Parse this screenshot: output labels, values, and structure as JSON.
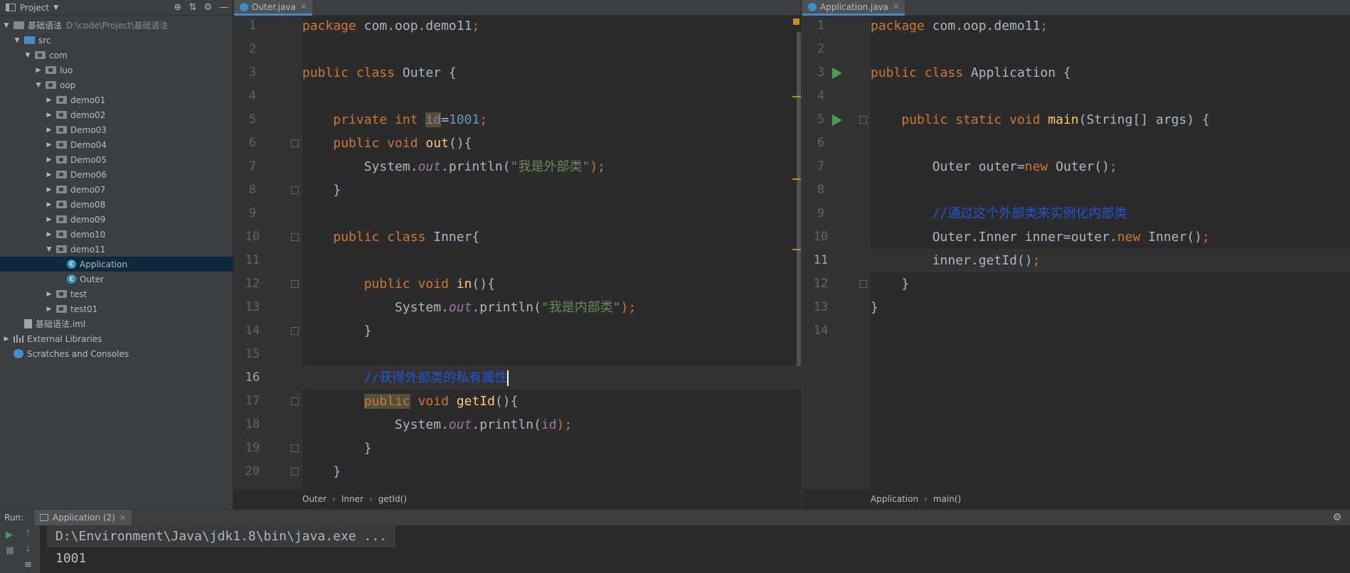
{
  "project_panel": {
    "title": "Project",
    "tree": [
      {
        "label": "基础语法",
        "hint": "D:\\code\\Project\\基础语法",
        "depth": 0,
        "arrow": "down",
        "icon": "folder"
      },
      {
        "label": "src",
        "depth": 1,
        "arrow": "down",
        "icon": "folder-blue"
      },
      {
        "label": "com",
        "depth": 2,
        "arrow": "down",
        "icon": "package"
      },
      {
        "label": "luo",
        "depth": 3,
        "arrow": "right",
        "icon": "package"
      },
      {
        "label": "oop",
        "depth": 3,
        "arrow": "down",
        "icon": "package"
      },
      {
        "label": "demo01",
        "depth": 4,
        "arrow": "right",
        "icon": "package"
      },
      {
        "label": "demo02",
        "depth": 4,
        "arrow": "right",
        "icon": "package"
      },
      {
        "label": "Demo03",
        "depth": 4,
        "arrow": "right",
        "icon": "package"
      },
      {
        "label": "Demo04",
        "depth": 4,
        "arrow": "right",
        "icon": "package"
      },
      {
        "label": "Demo05",
        "depth": 4,
        "arrow": "right",
        "icon": "package"
      },
      {
        "label": "Demo06",
        "depth": 4,
        "arrow": "right",
        "icon": "package"
      },
      {
        "label": "demo07",
        "depth": 4,
        "arrow": "right",
        "icon": "package"
      },
      {
        "label": "demo08",
        "depth": 4,
        "arrow": "right",
        "icon": "package"
      },
      {
        "label": "demo09",
        "depth": 4,
        "arrow": "right",
        "icon": "package"
      },
      {
        "label": "demo10",
        "depth": 4,
        "arrow": "right",
        "icon": "package"
      },
      {
        "label": "demo11",
        "depth": 4,
        "arrow": "down",
        "icon": "package"
      },
      {
        "label": "Application",
        "depth": 5,
        "arrow": "",
        "icon": "class",
        "selected": true
      },
      {
        "label": "Outer",
        "depth": 5,
        "arrow": "",
        "icon": "class"
      },
      {
        "label": "test",
        "depth": 4,
        "arrow": "right",
        "icon": "package"
      },
      {
        "label": "test01",
        "depth": 4,
        "arrow": "right",
        "icon": "package"
      },
      {
        "label": "基础语法.iml",
        "depth": 1,
        "arrow": "",
        "icon": "file"
      },
      {
        "label": "External Libraries",
        "depth": 0,
        "arrow": "right",
        "icon": "library"
      },
      {
        "label": "Scratches and Consoles",
        "depth": 0,
        "arrow": "",
        "icon": "scratch"
      }
    ]
  },
  "editor_left": {
    "tab": "Outer.java",
    "current_line": 16,
    "breadcrumb": [
      "Outer",
      "Inner",
      "getId()"
    ],
    "lines": [
      {
        "n": "1",
        "tokens": [
          {
            "t": "package ",
            "c": "kw"
          },
          {
            "t": "com.oop.demo11"
          },
          {
            "t": ";",
            "c": "kw"
          }
        ]
      },
      {
        "n": "2",
        "tokens": []
      },
      {
        "n": "3",
        "tokens": [
          {
            "t": "public class ",
            "c": "kw"
          },
          {
            "t": "Outer {"
          }
        ]
      },
      {
        "n": "4",
        "tokens": []
      },
      {
        "n": "5",
        "tokens": [
          {
            "t": "    "
          },
          {
            "t": "private int ",
            "c": "kw"
          },
          {
            "t": "id",
            "c": "fldn hl"
          },
          {
            "t": "="
          },
          {
            "t": "1001",
            "c": "num"
          },
          {
            "t": ";",
            "c": "kw"
          }
        ]
      },
      {
        "n": "6",
        "fold": true,
        "tokens": [
          {
            "t": "    "
          },
          {
            "t": "public void ",
            "c": "kw"
          },
          {
            "t": "out",
            "c": "fn"
          },
          {
            "t": "(){"
          }
        ]
      },
      {
        "n": "7",
        "tokens": [
          {
            "t": "        System."
          },
          {
            "t": "out",
            "c": "fld"
          },
          {
            "t": ".println("
          },
          {
            "t": "\"我是外部类\"",
            "c": "str"
          },
          {
            "t": ");",
            "c": "kw"
          }
        ]
      },
      {
        "n": "8",
        "fold": true,
        "tokens": [
          {
            "t": "    }"
          }
        ]
      },
      {
        "n": "9",
        "tokens": []
      },
      {
        "n": "10",
        "fold": true,
        "tokens": [
          {
            "t": "    "
          },
          {
            "t": "public class ",
            "c": "kw"
          },
          {
            "t": "Inner{"
          }
        ]
      },
      {
        "n": "11",
        "tokens": []
      },
      {
        "n": "12",
        "fold": true,
        "tokens": [
          {
            "t": "        "
          },
          {
            "t": "public void ",
            "c": "kw"
          },
          {
            "t": "in",
            "c": "fn"
          },
          {
            "t": "(){"
          }
        ]
      },
      {
        "n": "13",
        "tokens": [
          {
            "t": "            System."
          },
          {
            "t": "out",
            "c": "fld"
          },
          {
            "t": ".println("
          },
          {
            "t": "\"我是内部类\"",
            "c": "str"
          },
          {
            "t": ");",
            "c": "kw"
          }
        ]
      },
      {
        "n": "14",
        "fold": true,
        "tokens": [
          {
            "t": "        }"
          }
        ]
      },
      {
        "n": "15",
        "tokens": []
      },
      {
        "n": "16",
        "caret": true,
        "tokens": [
          {
            "t": "        "
          },
          {
            "t": "//获得外部类的私有属性",
            "c": "cmt"
          }
        ]
      },
      {
        "n": "17",
        "fold": true,
        "tokens": [
          {
            "t": "        "
          },
          {
            "t": "public",
            "c": "kw hl"
          },
          {
            "t": " void ",
            "c": "kw"
          },
          {
            "t": "getId",
            "c": "fn"
          },
          {
            "t": "(){"
          }
        ]
      },
      {
        "n": "18",
        "tokens": [
          {
            "t": "            System."
          },
          {
            "t": "out",
            "c": "fld"
          },
          {
            "t": ".println("
          },
          {
            "t": "id",
            "c": "fldn"
          },
          {
            "t": ");",
            "c": "kw"
          }
        ]
      },
      {
        "n": "19",
        "fold": true,
        "tokens": [
          {
            "t": "        }"
          }
        ]
      },
      {
        "n": "20",
        "fold": true,
        "tokens": [
          {
            "t": "    }"
          }
        ]
      }
    ]
  },
  "editor_right": {
    "tab": "Application.java",
    "current_line": 11,
    "breadcrumb": [
      "Application",
      "main()"
    ],
    "lines": [
      {
        "n": "1",
        "tokens": [
          {
            "t": "package ",
            "c": "kw"
          },
          {
            "t": "com.oop.demo11"
          },
          {
            "t": ";",
            "c": "kw"
          }
        ]
      },
      {
        "n": "2",
        "tokens": []
      },
      {
        "n": "3",
        "run": true,
        "tokens": [
          {
            "t": "public class ",
            "c": "kw"
          },
          {
            "t": "Application {"
          }
        ]
      },
      {
        "n": "4",
        "tokens": []
      },
      {
        "n": "5",
        "run": true,
        "fold": true,
        "tokens": [
          {
            "t": "    "
          },
          {
            "t": "public static void ",
            "c": "kw"
          },
          {
            "t": "main",
            "c": "fn"
          },
          {
            "t": "(String[] args) {"
          }
        ]
      },
      {
        "n": "6",
        "tokens": []
      },
      {
        "n": "7",
        "tokens": [
          {
            "t": "        Outer outer="
          },
          {
            "t": "new ",
            "c": "kw"
          },
          {
            "t": "Outer()"
          },
          {
            "t": ";",
            "c": "kw"
          }
        ]
      },
      {
        "n": "8",
        "tokens": []
      },
      {
        "n": "9",
        "tokens": [
          {
            "t": "        "
          },
          {
            "t": "//通过这个外部类来实例化内部类",
            "c": "cmt"
          }
        ]
      },
      {
        "n": "10",
        "tokens": [
          {
            "t": "        Outer.Inner inner=outer."
          },
          {
            "t": "new ",
            "c": "kw"
          },
          {
            "t": "Inner()"
          },
          {
            "t": ";",
            "c": "kw"
          }
        ]
      },
      {
        "n": "11",
        "tokens": [
          {
            "t": "        inner.getId()"
          },
          {
            "t": ";",
            "c": "kw"
          }
        ]
      },
      {
        "n": "12",
        "fold": true,
        "tokens": [
          {
            "t": "    }"
          }
        ]
      },
      {
        "n": "13",
        "tokens": [
          {
            "t": "}"
          }
        ]
      },
      {
        "n": "14",
        "tokens": []
      }
    ]
  },
  "run_panel": {
    "label": "Run:",
    "tab": "Application (2)",
    "console": {
      "command": "D:\\Environment\\Java\\jdk1.8\\bin\\java.exe ...",
      "output": "1001"
    }
  },
  "colors": {
    "keyword": "#cc7832",
    "function": "#ffc66d",
    "number": "#6897bb",
    "string": "#6a8759",
    "comment": "#2255d6",
    "field": "#9876aa",
    "run_icon": "#499c54"
  }
}
